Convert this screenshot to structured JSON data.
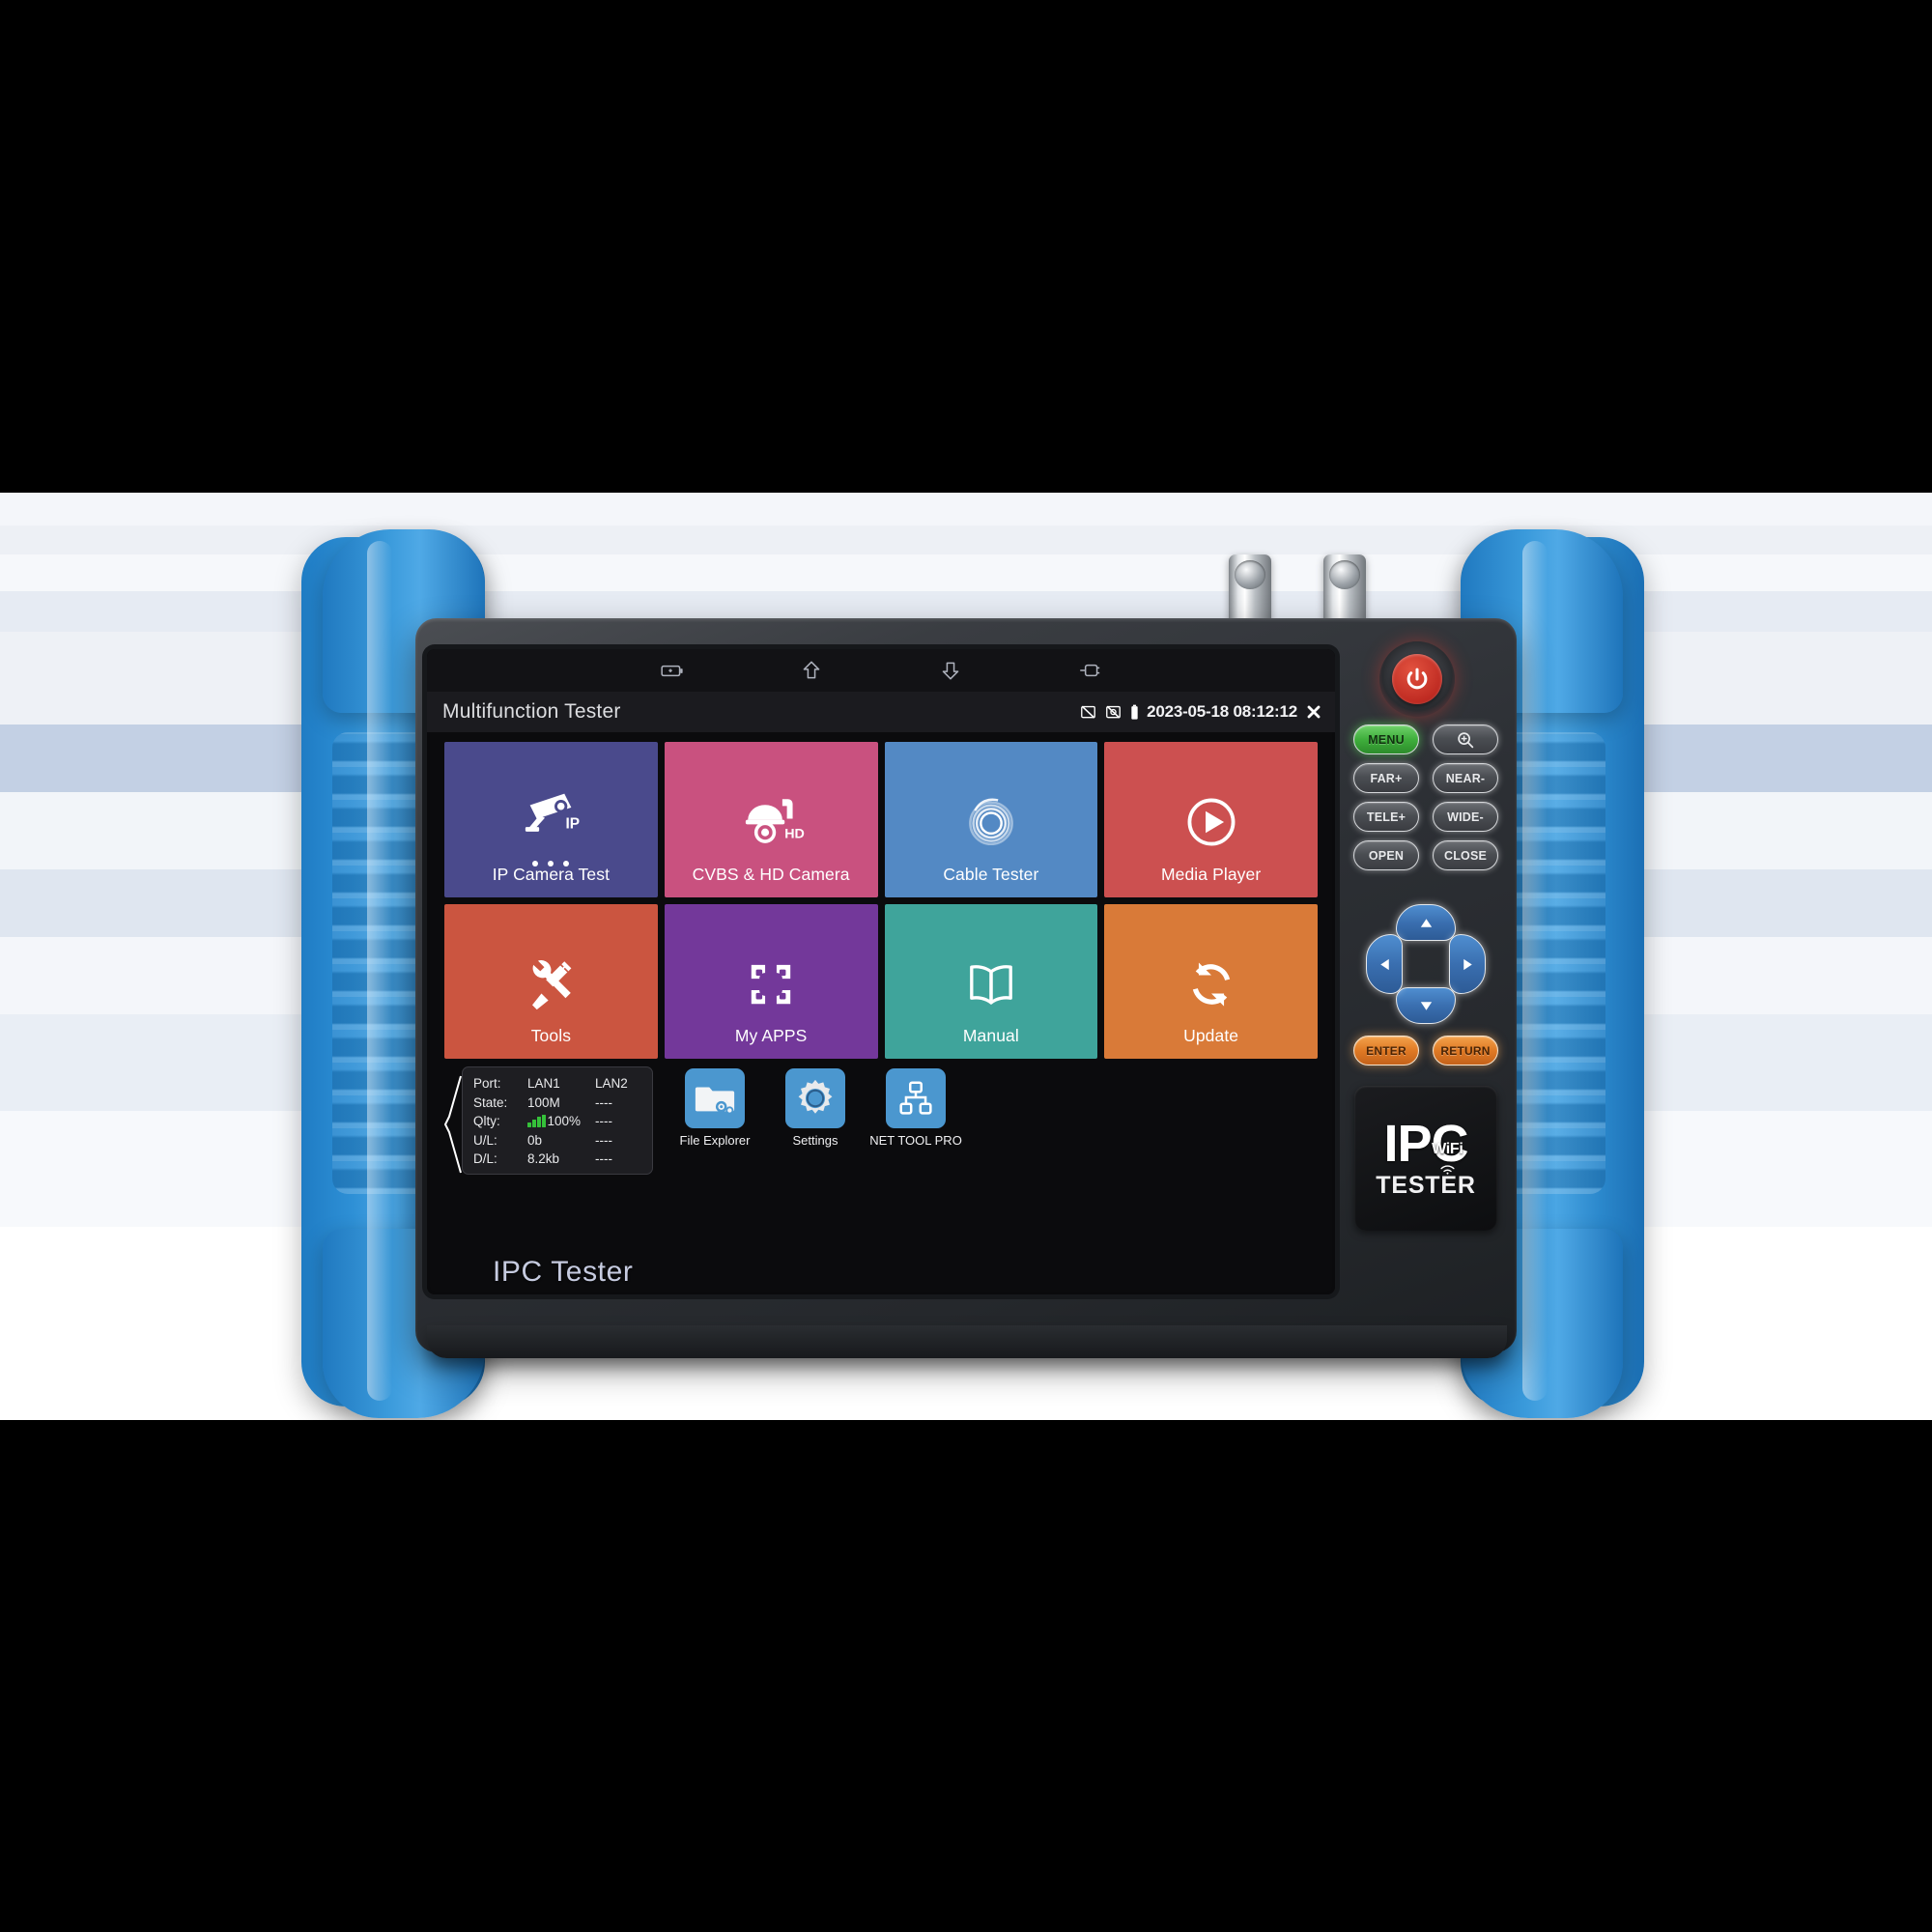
{
  "device": {
    "brand_bezel": "IPC Tester",
    "logo_primary": "IPC",
    "logo_wifi": "WiFi",
    "logo_secondary": "TESTER",
    "power_icon": "power-icon",
    "bnc_connectors": [
      "bnc-connector-1",
      "bnc-connector-2"
    ],
    "holster_color": "#2b88cc",
    "body_color": "#2c2f34"
  },
  "nav_bar": {
    "items": [
      {
        "icon": "battery-icon"
      },
      {
        "icon": "home-up-arrow-icon"
      },
      {
        "icon": "back-down-arrow-icon"
      },
      {
        "icon": "connector-plug-icon"
      }
    ]
  },
  "title_bar": {
    "title": "Multifunction Tester",
    "status_icons": [
      "no-display-icon",
      "no-screenshot-icon",
      "battery-full-icon"
    ],
    "clock": "2023-05-18 08:12:12",
    "close_icon": "close-x-icon"
  },
  "tiles": [
    {
      "label": "IP Camera Test",
      "icon": "bullet-camera-ip-icon",
      "color": "#4a4a8c",
      "badge": "IP",
      "dots": 3
    },
    {
      "label": "CVBS & HD Camera",
      "icon": "dome-camera-hd-icon",
      "color": "#c9517f",
      "badge": "HD"
    },
    {
      "label": "Cable Tester",
      "icon": "coiled-cable-icon",
      "color": "#5389c4"
    },
    {
      "label": "Media Player",
      "icon": "play-circle-icon",
      "color": "#cc5050"
    },
    {
      "label": "Tools",
      "icon": "wrench-screwdriver-icon",
      "color": "#cb5540"
    },
    {
      "label": "My APPS",
      "icon": "pinwheel-apps-icon",
      "color": "#73389a"
    },
    {
      "label": "Manual",
      "icon": "open-book-icon",
      "color": "#3fa49b"
    },
    {
      "label": "Update",
      "icon": "refresh-arrows-icon",
      "color": "#d97a38"
    }
  ],
  "lan_panel": {
    "bracket_icon": "brace-bracket-icon",
    "columns": [
      "LAN1",
      "LAN2"
    ],
    "rows": [
      {
        "key": "Port:",
        "lan1": "LAN1",
        "lan2": "LAN2"
      },
      {
        "key": "State:",
        "lan1": "100M",
        "lan2": "----"
      },
      {
        "key": "Qlty:",
        "lan1": "100%",
        "lan2": "----",
        "signal_icon": "signal-bars-icon",
        "signal_color": "#35c13a"
      },
      {
        "key": "U/L:",
        "lan1": "0b",
        "lan2": "----"
      },
      {
        "key": "D/L:",
        "lan1": "8.2kb",
        "lan2": "----"
      }
    ]
  },
  "dock": [
    {
      "label": "File Explorer",
      "icon": "folder-gears-icon"
    },
    {
      "label": "Settings",
      "icon": "gear-icon"
    },
    {
      "label": "NET TOOL PRO",
      "icon": "network-tree-icon"
    }
  ],
  "keypad": {
    "keys": [
      {
        "label": "MENU",
        "style": "green"
      },
      {
        "label": "",
        "style": "icon",
        "icon": "zoom-in-icon"
      },
      {
        "label": "FAR+",
        "style": "plain"
      },
      {
        "label": "NEAR-",
        "style": "plain"
      },
      {
        "label": "TELE+",
        "style": "plain"
      },
      {
        "label": "WIDE-",
        "style": "plain"
      },
      {
        "label": "OPEN",
        "style": "plain"
      },
      {
        "label": "CLOSE",
        "style": "plain"
      }
    ],
    "dpad": [
      {
        "dir": "up",
        "icon": "arrow-up-icon"
      },
      {
        "dir": "right",
        "icon": "arrow-right-icon"
      },
      {
        "dir": "down",
        "icon": "arrow-down-icon"
      },
      {
        "dir": "left",
        "icon": "arrow-left-icon"
      }
    ],
    "enter_label": "ENTER",
    "return_label": "RETURN"
  }
}
